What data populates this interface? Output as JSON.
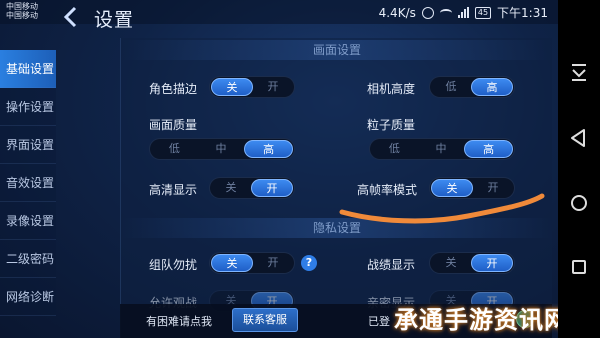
{
  "status_bar": {
    "carrier_line1": "中国移动",
    "carrier_line2": "中国移动",
    "speed": "4.4K/s",
    "battery": "45",
    "time": "下午1:31"
  },
  "header": {
    "title": "设置"
  },
  "sidebar": {
    "items": [
      {
        "label": "基础设置",
        "active": true
      },
      {
        "label": "操作设置",
        "active": false
      },
      {
        "label": "界面设置",
        "active": false
      },
      {
        "label": "音效设置",
        "active": false
      },
      {
        "label": "录像设置",
        "active": false
      },
      {
        "label": "二级密码",
        "active": false
      },
      {
        "label": "网络诊断",
        "active": false
      }
    ]
  },
  "graphics_section": {
    "title": "画面设置",
    "outline": {
      "label": "角色描边",
      "options": [
        "关",
        "开"
      ],
      "selected": "关"
    },
    "camera_height": {
      "label": "相机高度",
      "options": [
        "低",
        "高"
      ],
      "selected": "高"
    },
    "quality": {
      "label": "画面质量",
      "options": [
        "低",
        "中",
        "高"
      ],
      "selected": "高"
    },
    "particles": {
      "label": "粒子质量",
      "options": [
        "低",
        "中",
        "高"
      ],
      "selected": "高"
    },
    "hd_display": {
      "label": "高清显示",
      "options": [
        "关",
        "开"
      ],
      "selected": "开"
    },
    "high_fps": {
      "label": "高帧率模式",
      "options": [
        "关",
        "开"
      ],
      "selected": "关"
    }
  },
  "privacy_section": {
    "title": "隐私设置",
    "team_dnd": {
      "label": "组队勿扰",
      "options": [
        "关",
        "开"
      ],
      "selected": "关"
    },
    "battle_display": {
      "label": "战绩显示",
      "options": [
        "关",
        "开"
      ],
      "selected": "开"
    },
    "partial_left": {
      "label": "允许观战",
      "options": [
        "关",
        "开"
      ],
      "selected": "开"
    },
    "partial_right": {
      "label": "亲密显示",
      "options": [
        "关",
        "开"
      ],
      "selected": "开"
    }
  },
  "footer": {
    "help_text": "有困难请点我",
    "contact_button": "联系客服",
    "status_text": "已登"
  },
  "watermark": "承通手游资讯网",
  "colors": {
    "accent": "#2f7de6",
    "background": "#0f2347",
    "annotation": "#f08a3a"
  }
}
